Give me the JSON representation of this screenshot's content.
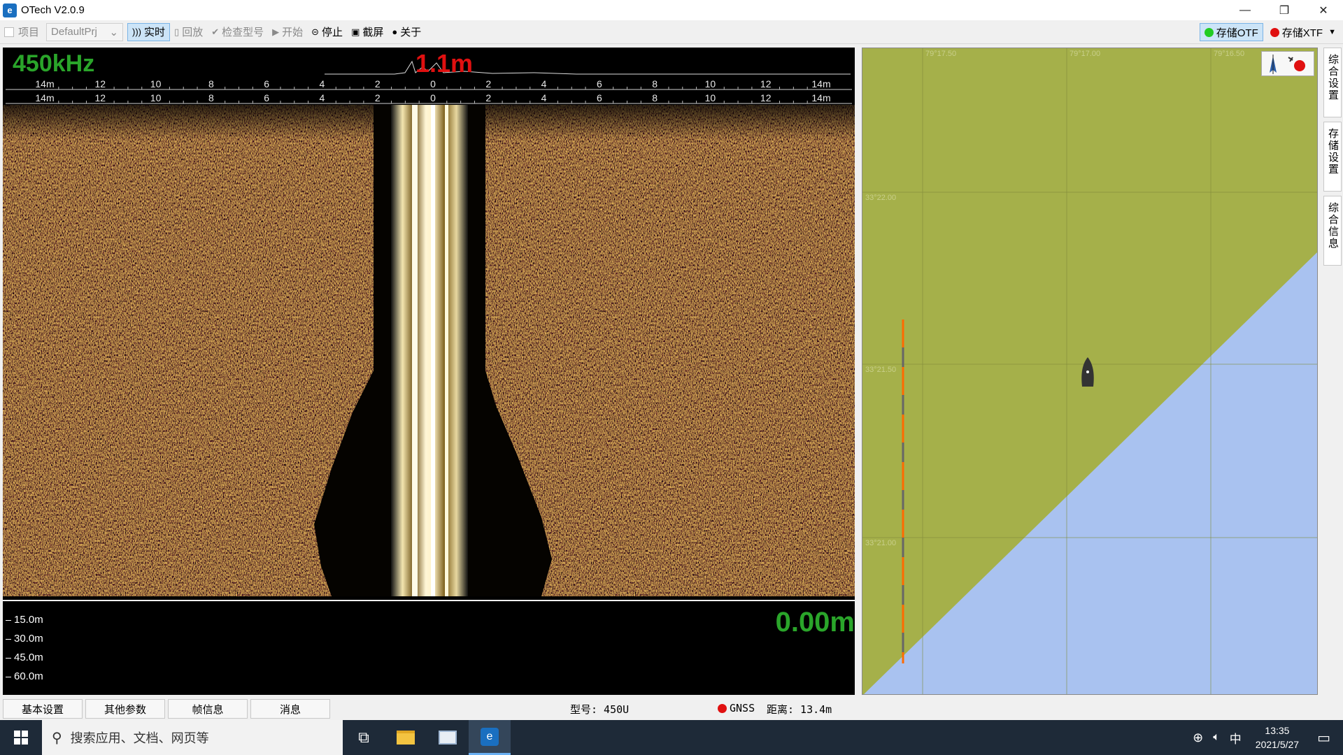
{
  "window": {
    "title": "OTech V2.0.9",
    "controls": [
      "—",
      "❐",
      "✕"
    ]
  },
  "toolbar": {
    "project_label": "项目",
    "project_value": "DefaultPrj",
    "realtime_label": "实时",
    "playback_label": "回放",
    "check_model_label": "检查型号",
    "start_label": "开始",
    "stop_label": "停止",
    "screenshot_label": "截屏",
    "about_label": "关于",
    "store_otf_label": "存储OTF",
    "store_xtf_label": "存储XTF"
  },
  "sonar": {
    "frequency": "450kHz",
    "altitude": "1.1m",
    "ruler_left": [
      "14m",
      "12",
      "10",
      "8",
      "6",
      "4",
      "2"
    ],
    "ruler_center": "0",
    "ruler_right": [
      "2",
      "4",
      "6",
      "8",
      "10",
      "12",
      "14m"
    ]
  },
  "depth": {
    "ticks": [
      "15.0m",
      "30.0m",
      "45.0m",
      "60.0m"
    ],
    "value": "0.00m"
  },
  "map": {
    "lon_labels": [
      "79°17.50",
      "79°17.00",
      "79°16.50"
    ],
    "lat_labels": [
      "33°22.00",
      "33°21.50",
      "33°21.00"
    ],
    "land_color": "#a5b04a",
    "water_color": "#a9c2f0"
  },
  "side_tabs": [
    "综合设置",
    "存储设置",
    "综合信息"
  ],
  "bottom_tabs": [
    "基本设置",
    "其他参数",
    "帧信息",
    "消息"
  ],
  "status": {
    "model": "型号: 450U",
    "gnss": "GNSS",
    "distance": "距离: 13.4m"
  },
  "taskbar": {
    "search_placeholder": "搜索应用、文档、网页等",
    "ime": "中",
    "time": "13:35",
    "date": "2021/5/27"
  }
}
